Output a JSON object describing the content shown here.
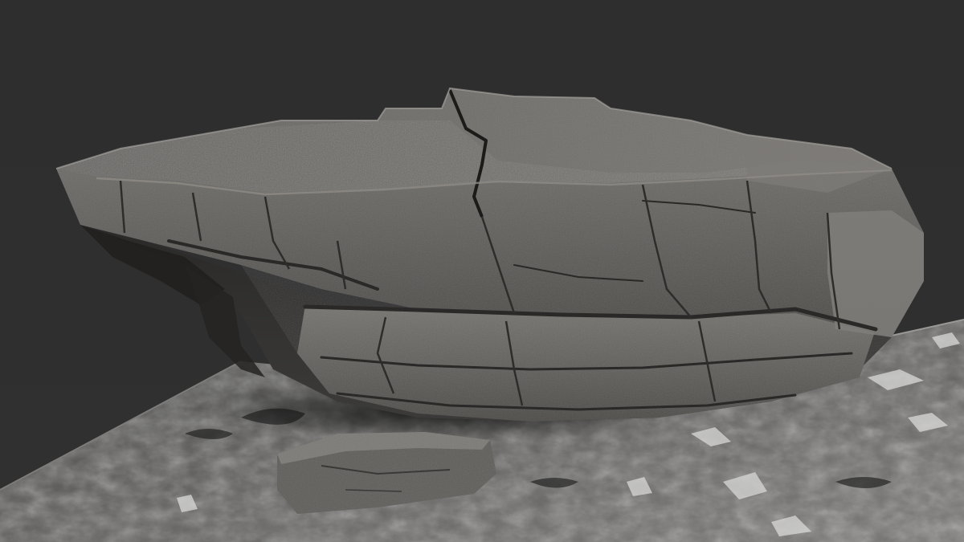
{
  "scene": {
    "subject": "sculpted-rock-slab-on-terrain",
    "background_color": "#2f2f2f",
    "rock_color": "#6a6864",
    "rock_shadow_color": "#2c2b29",
    "rock_highlight_color": "#8d8a85",
    "terrain_color": "#5a5957",
    "terrain_highlight_color": "#d8d8d8"
  }
}
